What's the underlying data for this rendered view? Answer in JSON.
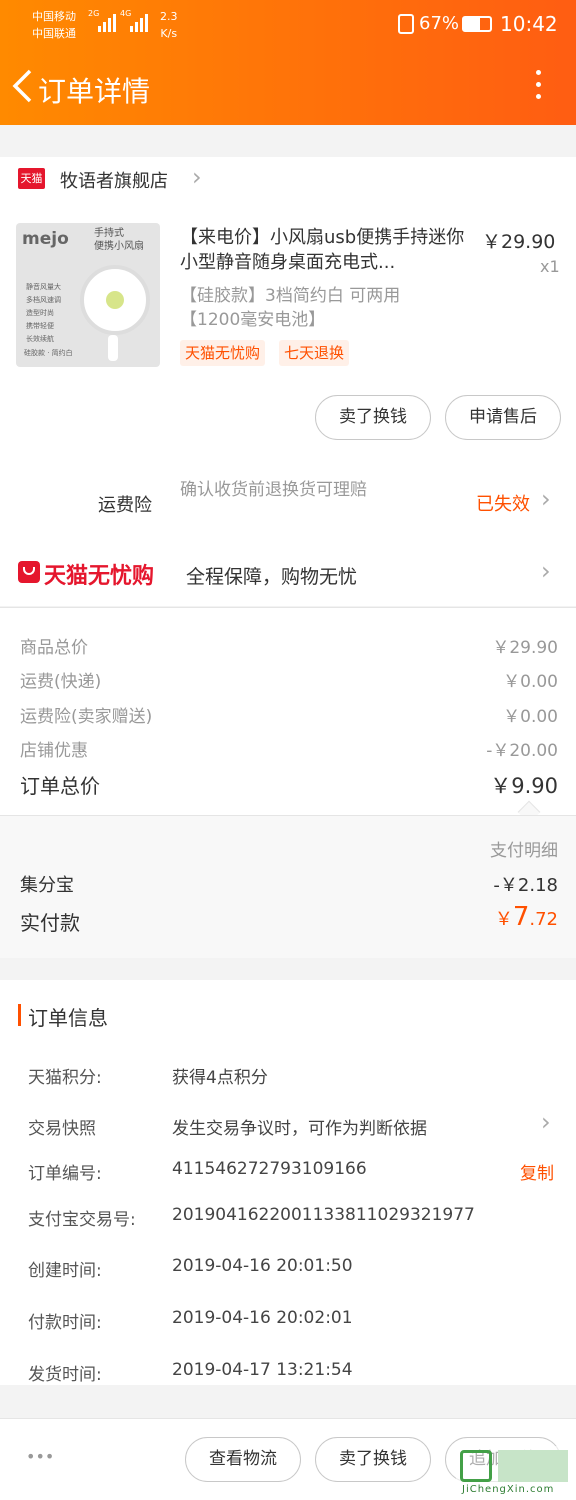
{
  "status_bar": {
    "carrier1": "中国移动",
    "carrier2": "中国联通",
    "net1": "2G",
    "net2": "4G",
    "speed_value": "2.3",
    "speed_unit": "K/s",
    "battery": "67%",
    "time": "10:42"
  },
  "header": {
    "title": "订单详情"
  },
  "shop": {
    "badge": "天猫",
    "name": "牧语者旗舰店"
  },
  "product": {
    "title": "【来电价】小风扇usb便携手持迷你小型静音随身桌面充电式...",
    "variant": "【硅胶款】3档简约白 可两用【1200毫安电池】",
    "price": "￥29.90",
    "qty": "x1",
    "tags": [
      "天猫无忧购",
      "七天退换"
    ],
    "image": {
      "brand": "mejo",
      "caption_line1": "手持式",
      "caption_line2": "便携小风扇",
      "features": [
        "静音风量大",
        "多档风速调",
        "造型时尚",
        "携带轻便",
        "长效续航"
      ],
      "footer_text": "硅胶款 · 简约白"
    }
  },
  "item_actions": {
    "sell": "卖了换钱",
    "after_sale": "申请售后"
  },
  "freight_insurance": {
    "label": "运费险",
    "desc": "确认收货前退换货可理赔",
    "status": "已失效"
  },
  "tmall_guarantee": {
    "logo": "天猫无忧购",
    "text": "全程保障，购物无忧"
  },
  "price_summary": {
    "rows": [
      {
        "label": "商品总价",
        "value": "￥29.90"
      },
      {
        "label": "运费(快递)",
        "value": "￥0.00"
      },
      {
        "label": "运费险(卖家赠送)",
        "value": "￥0.00"
      },
      {
        "label": "店铺优惠",
        "value": "-￥20.00"
      }
    ],
    "total_label": "订单总价",
    "total_value": "￥9.90"
  },
  "payment": {
    "detail_label": "支付明细",
    "jifenbao_label": "集分宝",
    "jifenbao_value": "-￥2.18",
    "paid_label": "实付款",
    "paid_symbol": "￥",
    "paid_int": "7",
    "paid_dec": ".72"
  },
  "order_info": {
    "title": "订单信息",
    "points_label": "天猫积分:",
    "points_value": "获得4点积分",
    "snapshot_label": "交易快照",
    "snapshot_value": "发生交易争议时，可作为判断依据",
    "order_no_label": "订单编号:",
    "order_no_value": "411546272793109166",
    "copy_label": "复制",
    "alipay_label": "支付宝交易号:",
    "alipay_value": "2019041622001133811029321977",
    "created_label": "创建时间:",
    "created_value": "2019-04-16 20:01:50",
    "paid_time_label": "付款时间:",
    "paid_time_value": "2019-04-16 20:02:01",
    "shipped_label": "发货时间:",
    "shipped_value": "2019-04-17 13:21:54"
  },
  "bottom_bar": {
    "more": "•••",
    "logistics": "查看物流",
    "sell": "卖了换钱",
    "review": "追加评价"
  },
  "watermark": {
    "text": "JiChengXin.com"
  },
  "colors": {
    "accent": "#ff5000",
    "header_start": "#ff8a00",
    "header_end": "#ff5d12",
    "tmall_red": "#e5162d"
  }
}
